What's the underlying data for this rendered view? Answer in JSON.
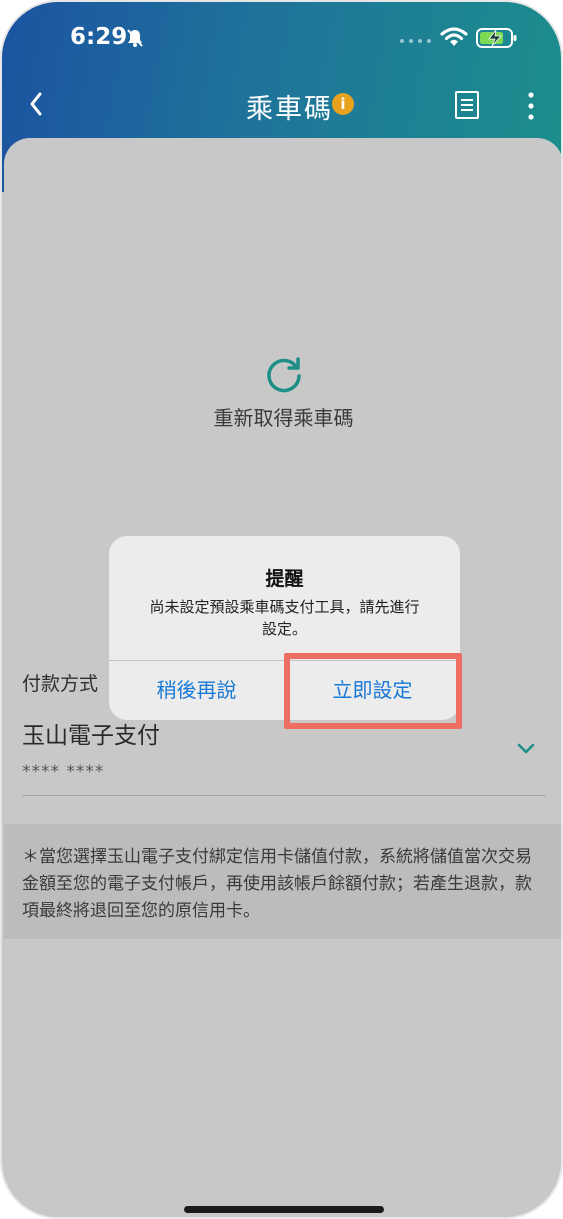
{
  "status_bar": {
    "time": "6:29"
  },
  "nav": {
    "title": "乘車碼",
    "info_glyph": "i"
  },
  "main": {
    "refresh_label": "重新取得乘車碼",
    "payment_label": "付款方式",
    "payment_value": "玉山電子支付",
    "masked_card": "**** ****",
    "notice": "＊當您選擇玉山電子支付綁定信用卡儲值付款，系統將儲值當次交易金額至您的電子支付帳戶，再使用該帳戶餘額付款；若產生退款，款項最終將退回至您的原信用卡。"
  },
  "dialog": {
    "title": "提醒",
    "message": "尚未設定預設乘車碼支付工具，請先進行設定。",
    "later_label": "稍後再說",
    "setup_label": "立即設定"
  },
  "colors": {
    "header_start": "#1f5fb8",
    "header_end": "#1fa3a0",
    "accent_teal": "#1e8f86",
    "link_blue": "#1778d6",
    "highlight_red": "#ee6e64",
    "info_orange": "#e8a21e"
  }
}
